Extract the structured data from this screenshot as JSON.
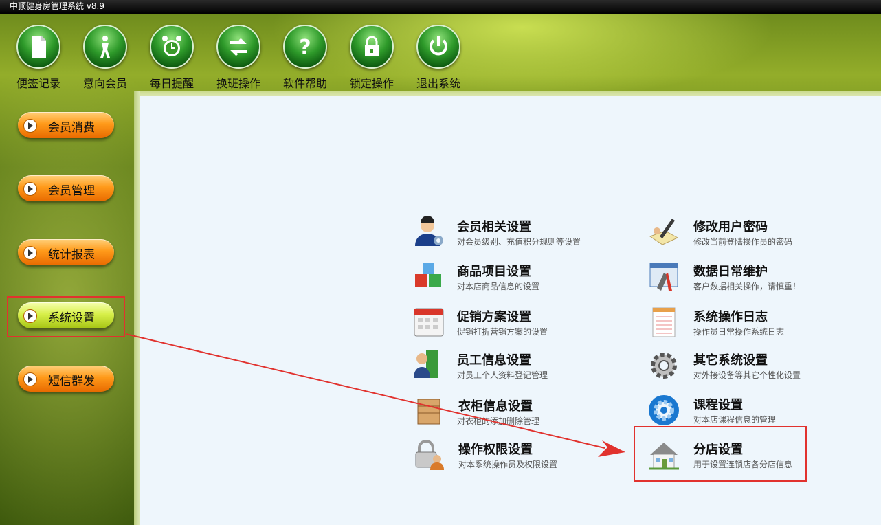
{
  "window": {
    "title": "中顶健身房管理系统  v8.9"
  },
  "toolbar": [
    {
      "label": "便签记录",
      "icon": "note-icon"
    },
    {
      "label": "意向会员",
      "icon": "person-icon"
    },
    {
      "label": "每日提醒",
      "icon": "alarm-clock-icon"
    },
    {
      "label": "换班操作",
      "icon": "swap-arrows-icon"
    },
    {
      "label": "软件帮助",
      "icon": "help-icon"
    },
    {
      "label": "锁定操作",
      "icon": "lock-icon"
    },
    {
      "label": "退出系统",
      "icon": "power-icon"
    }
  ],
  "sidebar": [
    {
      "label": "会员消费",
      "active": false
    },
    {
      "label": "会员管理",
      "active": false
    },
    {
      "label": "统计报表",
      "active": false
    },
    {
      "label": "系统设置",
      "active": true
    },
    {
      "label": "短信群发",
      "active": false
    }
  ],
  "settings": [
    {
      "title": "会员相关设置",
      "desc": "对会员级别、充值积分规则等设置",
      "icon": "member-settings-icon"
    },
    {
      "title": "修改用户密码",
      "desc": "修改当前登陆操作员的密码",
      "icon": "password-edit-icon"
    },
    {
      "title": "商品项目设置",
      "desc": "对本店商品信息的设置",
      "icon": "product-cubes-icon"
    },
    {
      "title": "数据日常维护",
      "desc": "客户数据相关操作，请慎重！",
      "icon": "data-maintenance-icon"
    },
    {
      "title": "促销方案设置",
      "desc": "促销打折营销方案的设置",
      "icon": "calendar-icon"
    },
    {
      "title": "系统操作日志",
      "desc": "操作员日常操作系统日志",
      "icon": "notepad-icon"
    },
    {
      "title": "员工信息设置",
      "desc": "对员工个人资料登记管理",
      "icon": "employee-icon"
    },
    {
      "title": "其它系统设置",
      "desc": "对外接设备等其它个性化设置",
      "icon": "gear-icon"
    },
    {
      "title": "衣柜信息设置",
      "desc": "对衣柜的添加删除管理",
      "icon": "locker-box-icon"
    },
    {
      "title": "课程设置",
      "desc": "对本店课程信息的管理",
      "icon": "course-gear-icon"
    },
    {
      "title": "操作权限设置",
      "desc": "对本系统操作员及权限设置",
      "icon": "permission-lock-icon"
    },
    {
      "title": "分店设置",
      "desc": "用于设置连锁店各分店信息",
      "icon": "house-icon"
    }
  ],
  "colors": {
    "highlight": "#e1322e",
    "accent_green": "#7a9a22",
    "button_orange": "#ff9a1a"
  }
}
